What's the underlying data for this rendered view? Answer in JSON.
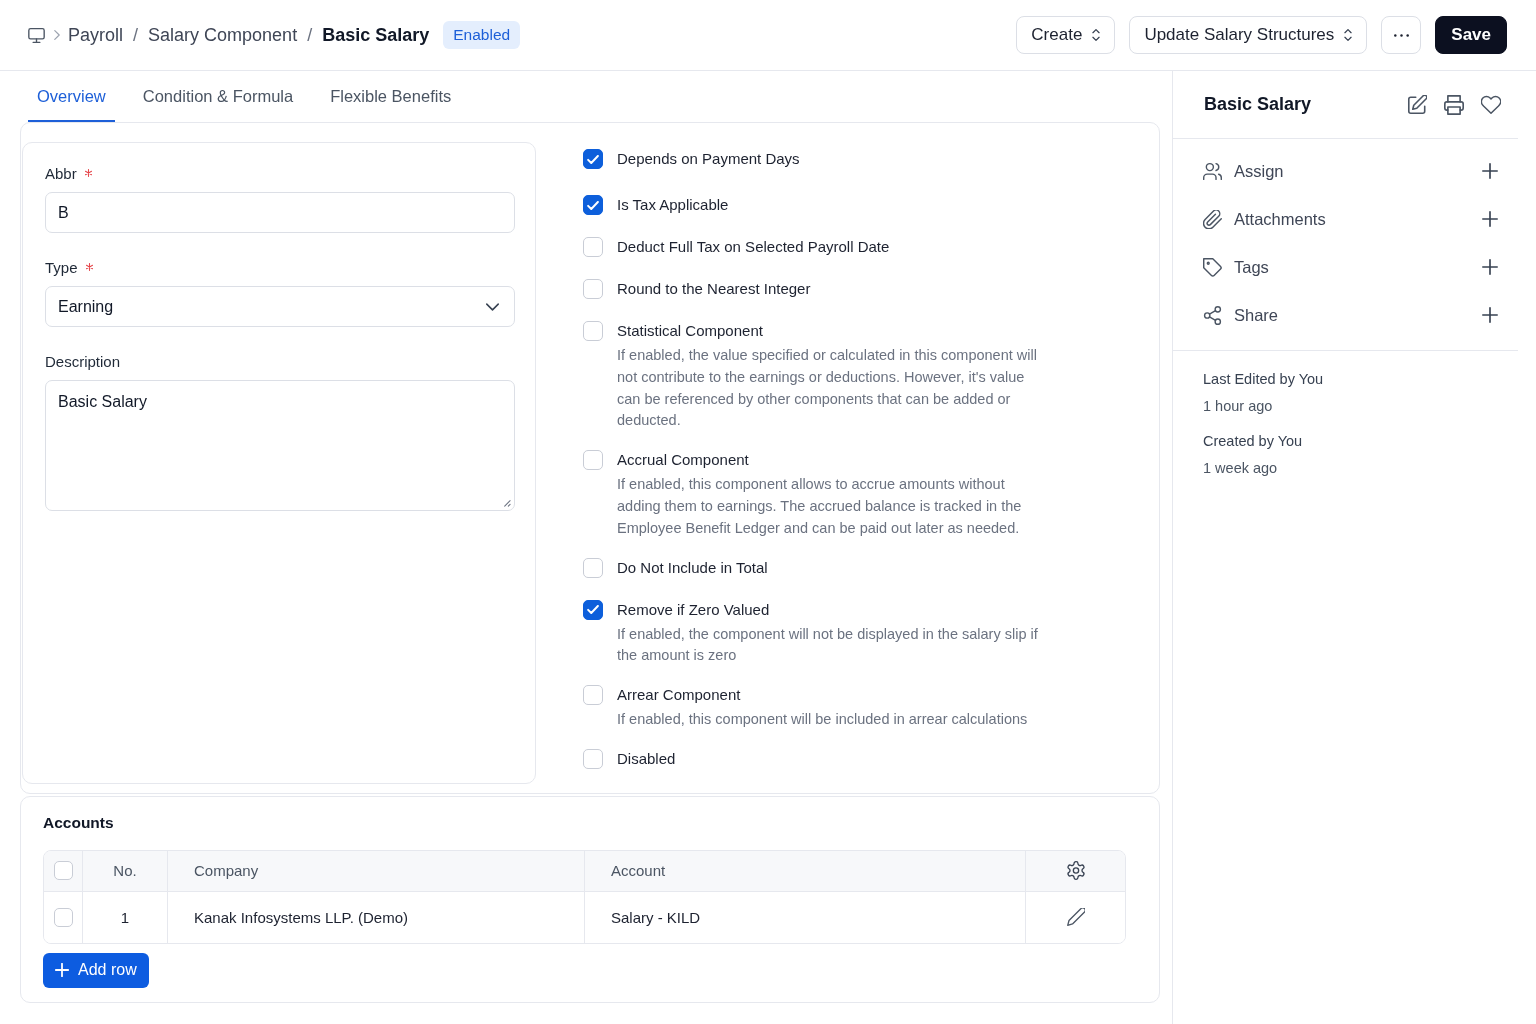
{
  "header": {
    "breadcrumbs": [
      {
        "kind": "link",
        "text": "Payroll"
      },
      {
        "kind": "separator",
        "text": "/"
      },
      {
        "kind": "link",
        "text": "Salary Component"
      },
      {
        "kind": "separator",
        "text": "/"
      },
      {
        "kind": "current",
        "text": "Basic Salary"
      }
    ],
    "status_badge": "Enabled",
    "actions": [
      {
        "kind": "dropdown",
        "label": "Create"
      },
      {
        "kind": "dropdown",
        "label": "Update Salary Structures"
      },
      {
        "kind": "more"
      },
      {
        "kind": "primary",
        "label": "Save"
      }
    ]
  },
  "tabs": [
    {
      "label": "Overview",
      "selected": true
    },
    {
      "label": "Condition & Formula",
      "selected": false
    },
    {
      "label": "Flexible Benefits",
      "selected": false
    }
  ],
  "fields": [
    {
      "kind": "text",
      "label": "Abbr",
      "required": true,
      "value": "B"
    },
    {
      "kind": "select",
      "label": "Type",
      "required": true,
      "value": "Earning"
    },
    {
      "kind": "textarea",
      "label": "Description",
      "required": false,
      "value": "Basic Salary"
    }
  ],
  "checkboxes": [
    {
      "label": "Depends on Payment Days",
      "checked": true
    },
    {
      "label": "Is Tax Applicable",
      "checked": true
    },
    {
      "label": "Deduct Full Tax on Selected Payroll Date",
      "checked": false
    },
    {
      "label": "Round to the Nearest Integer",
      "checked": false
    },
    {
      "label": "Statistical Component",
      "checked": false,
      "description": "If enabled, the value specified or calculated in this component will not contribute to the earnings or deductions. However, it's value can be referenced by other components that can be added or deducted."
    },
    {
      "label": "Accrual Component",
      "checked": false,
      "description": "If enabled, this component allows to accrue amounts without adding them to earnings. The accrued balance is tracked in the Employee Benefit Ledger and can be paid out later as needed."
    },
    {
      "label": "Do Not Include in Total",
      "checked": false
    },
    {
      "label": "Remove if Zero Valued",
      "checked": true,
      "description": "If enabled, the component will not be displayed in the salary slip if the amount is zero"
    },
    {
      "label": "Arrear Component",
      "checked": false,
      "description": "If enabled, this component will be included in arrear calculations"
    },
    {
      "label": "Disabled",
      "checked": false
    }
  ],
  "accounts": {
    "title": "Accounts",
    "select_all": {
      "checked": false
    },
    "columns": [
      "No.",
      "Company",
      "Account"
    ],
    "rows": [
      {
        "selected": false,
        "cells": [
          "1",
          "Kanak Infosystems LLP. (Demo)",
          "Salary - KILD"
        ]
      }
    ],
    "add_row": "Add row"
  },
  "sidebar": {
    "title": "Basic Salary",
    "actions": [
      {
        "label": "Assign"
      },
      {
        "label": "Attachments"
      },
      {
        "label": "Tags"
      },
      {
        "label": "Share"
      }
    ],
    "activity": [
      {
        "text": "Last Edited by You",
        "time": "1 hour ago"
      },
      {
        "text": "Created by You",
        "time": "1 week ago"
      }
    ]
  }
}
